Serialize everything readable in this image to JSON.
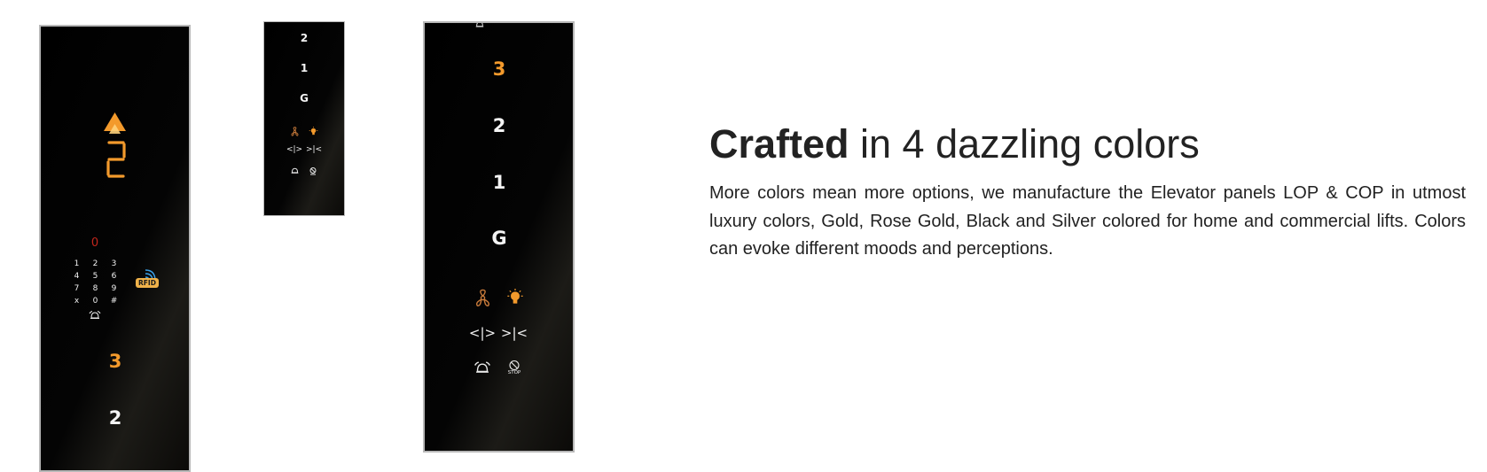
{
  "panel1": {
    "direction_icon": "up-arrow-icon",
    "floor_display": "2",
    "keypad_display": "0",
    "keypad_keys": [
      "1",
      "2",
      "3",
      "4",
      "5",
      "6",
      "7",
      "8",
      "9",
      "x",
      "0",
      "#"
    ],
    "rfid_label": "RFID",
    "floor_button_active": "3",
    "floor_button": "2"
  },
  "panel2": {
    "floors": [
      "2",
      "1",
      "G"
    ],
    "door_open": "<|>",
    "door_close": ">|<"
  },
  "panel3": {
    "floors": [
      "3",
      "2",
      "1",
      "G"
    ],
    "door_open": "<|>",
    "door_close": ">|<",
    "stop_label": "STOP"
  },
  "content": {
    "heading_bold": "Crafted",
    "heading_rest": " in 4 dazzling colors",
    "paragraph": "More colors mean more options, we manufacture the Elevator panels LOP & COP in utmost luxury colors, Gold, Rose Gold, Black and Silver colored for home and commercial lifts. Colors can evoke different moods and perceptions."
  },
  "colors": {
    "accent_orange": "#f39a2c",
    "panel_black": "#000000",
    "text": "#222222"
  }
}
